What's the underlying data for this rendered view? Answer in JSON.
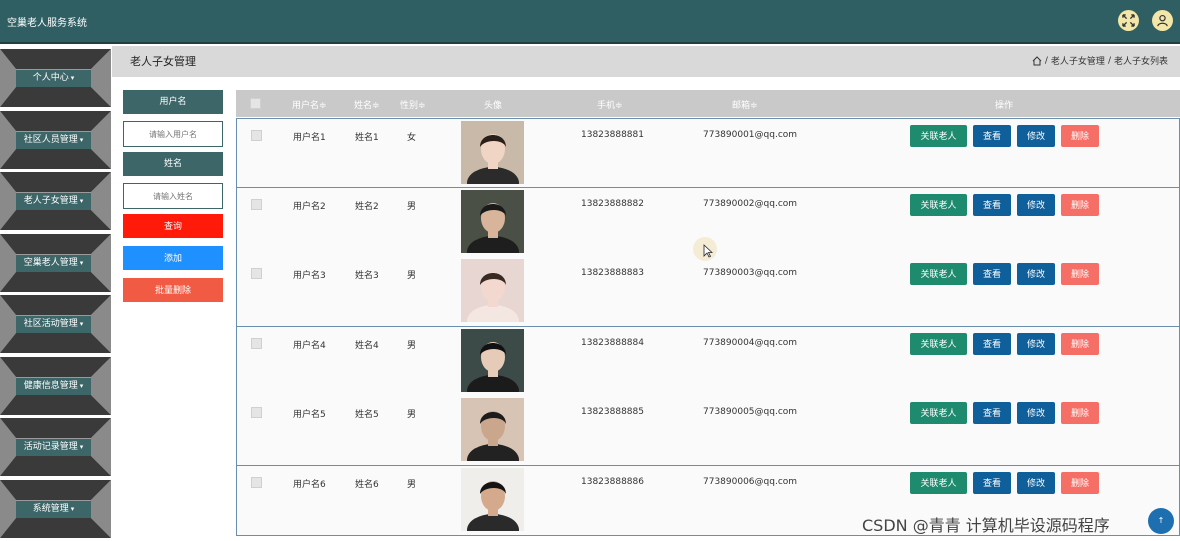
{
  "app": {
    "title": "空巢老人服务系统"
  },
  "topbar_icons": [
    "expand-icon",
    "user-icon"
  ],
  "sidebar": {
    "items": [
      {
        "label": "个人中心"
      },
      {
        "label": "社区人员管理"
      },
      {
        "label": "老人子女管理"
      },
      {
        "label": "空巢老人管理"
      },
      {
        "label": "社区活动管理"
      },
      {
        "label": "健康信息管理"
      },
      {
        "label": "活动记录管理"
      },
      {
        "label": "系统管理"
      }
    ]
  },
  "header": {
    "page_title": "老人子女管理",
    "breadcrumb": [
      " / ",
      "老人子女管理",
      " / ",
      "老人子女列表"
    ]
  },
  "filter": {
    "username_label": "用户名",
    "username_placeholder": "请输入用户名",
    "name_label": "姓名",
    "name_placeholder": "请输入姓名",
    "query_button": "查询",
    "add_button": "添加",
    "batch_delete_button": "批量删除",
    "colors": {
      "query": "#ff1a0a",
      "add": "#1e90ff",
      "batch_delete": "#f15a43"
    }
  },
  "table": {
    "columns": [
      "用户名",
      "姓名",
      "性别",
      "头像",
      "手机",
      "邮箱",
      "操作"
    ],
    "sort_marks": [
      "≑",
      "≑",
      "≑",
      "",
      "≑",
      "≑",
      ""
    ],
    "actions": {
      "link": "关联老人",
      "view": "查看",
      "edit": "修改",
      "delete": "删除"
    },
    "rows": [
      {
        "username": "用户名1",
        "name": "姓名1",
        "gender": "女",
        "phone": "13823888881",
        "email": "773890001@qq.com"
      },
      {
        "username": "用户名2",
        "name": "姓名2",
        "gender": "男",
        "phone": "13823888882",
        "email": "773890002@qq.com"
      },
      {
        "username": "用户名3",
        "name": "姓名3",
        "gender": "男",
        "phone": "13823888883",
        "email": "773890003@qq.com"
      },
      {
        "username": "用户名4",
        "name": "姓名4",
        "gender": "男",
        "phone": "13823888884",
        "email": "773890004@qq.com"
      },
      {
        "username": "用户名5",
        "name": "姓名5",
        "gender": "男",
        "phone": "13823888885",
        "email": "773890005@qq.com"
      },
      {
        "username": "用户名6",
        "name": "姓名6",
        "gender": "男",
        "phone": "13823888886",
        "email": "773890006@qq.com"
      }
    ]
  },
  "watermark": "CSDN @青青  计算机毕设源码程序",
  "corner_badge": "↑"
}
